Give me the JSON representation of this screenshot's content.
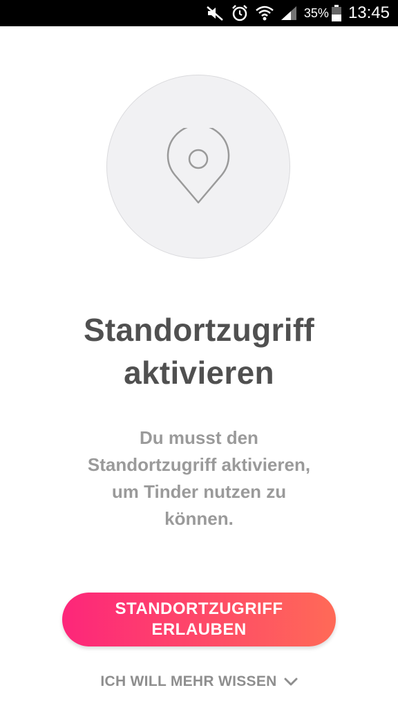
{
  "status_bar": {
    "icons": [
      "mute-icon",
      "alarm-icon",
      "wifi-icon",
      "signal-icon"
    ],
    "battery_percent": "35%",
    "time": "13:45"
  },
  "illustration": {
    "icon": "location-pin-icon"
  },
  "title": {
    "line1": "Standortzugriff",
    "line2": "aktivieren"
  },
  "description": {
    "line1": "Du musst den",
    "line2": "Standortzugriff aktivieren,",
    "line3": "um Tinder nutzen zu",
    "line4": "können."
  },
  "primary_button": {
    "line1": "STANDORTZUGRIFF",
    "line2": "ERLAUBEN",
    "gradient_start": "#fd267a",
    "gradient_end": "#ff6a57"
  },
  "secondary_link": {
    "label": "ICH WILL MEHR WISSEN",
    "icon": "chevron-down-icon"
  },
  "colors": {
    "title": "#505050",
    "description": "#9a9a9a",
    "link": "#8e8e8e",
    "circle_bg": "#f1f1f3"
  }
}
